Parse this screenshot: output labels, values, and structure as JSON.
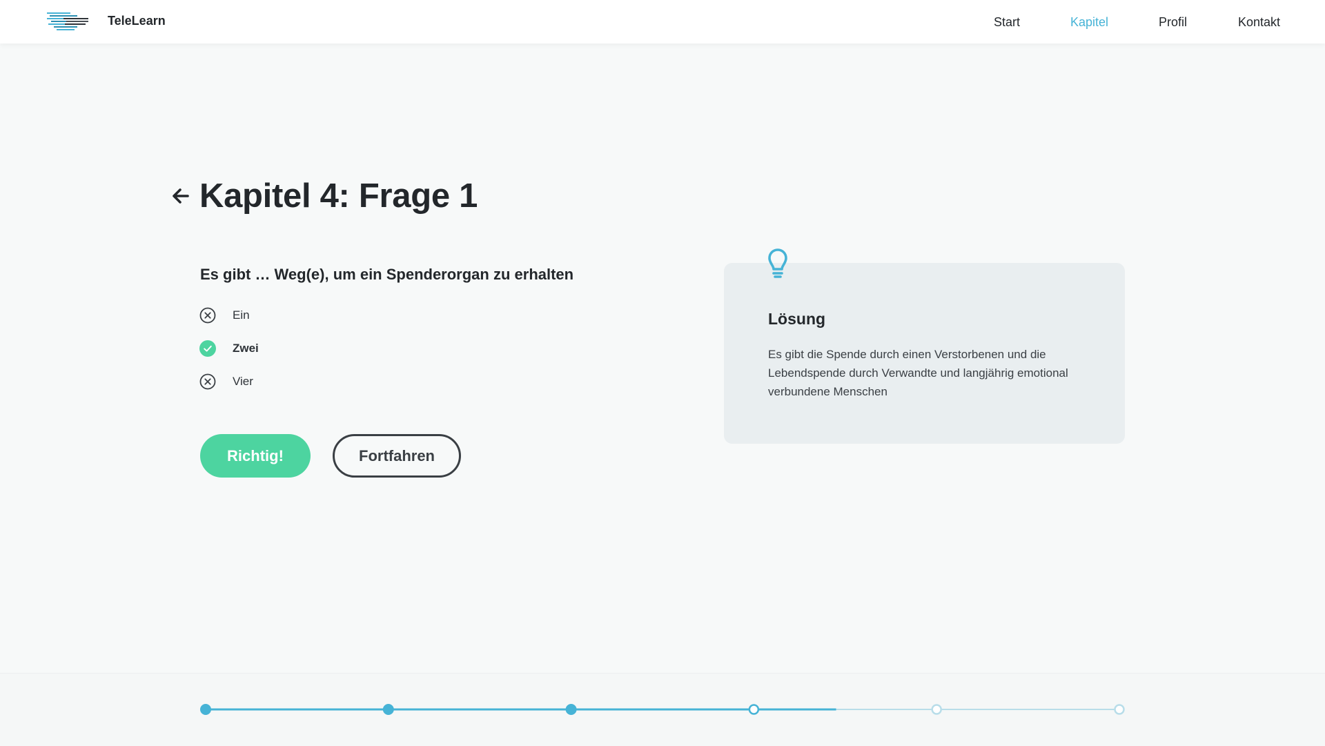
{
  "app": {
    "brand": "TeleLearn"
  },
  "nav": {
    "items": [
      {
        "label": "Start",
        "active": false
      },
      {
        "label": "Kapitel",
        "active": true
      },
      {
        "label": "Profil",
        "active": false
      },
      {
        "label": "Kontakt",
        "active": false
      }
    ]
  },
  "page": {
    "title": "Kapitel 4: Frage 1"
  },
  "question": {
    "text": "Es gibt … Weg(e), um ein Spenderorgan zu erhalten",
    "answers": [
      {
        "label": "Ein",
        "state": "wrong"
      },
      {
        "label": "Zwei",
        "state": "correct"
      },
      {
        "label": "Vier",
        "state": "wrong"
      }
    ]
  },
  "buttons": {
    "result_label": "Richtig!",
    "continue_label": "Fortfahren"
  },
  "solution": {
    "icon": "lightbulb-icon",
    "title": "Lösung",
    "text": "Es gibt die Spende durch einen Verstorbenen und die Lebendspende durch Verwandte und langjährig emotional verbundene Menschen"
  },
  "progress": {
    "total_steps": 6,
    "completed_steps": 3,
    "current_step": 4,
    "fill_fraction": 0.69
  },
  "colors": {
    "accent": "#46b3d6",
    "correct": "#4dd4a0",
    "progress_light": "#b8dde9",
    "text_dark": "#23272b"
  }
}
